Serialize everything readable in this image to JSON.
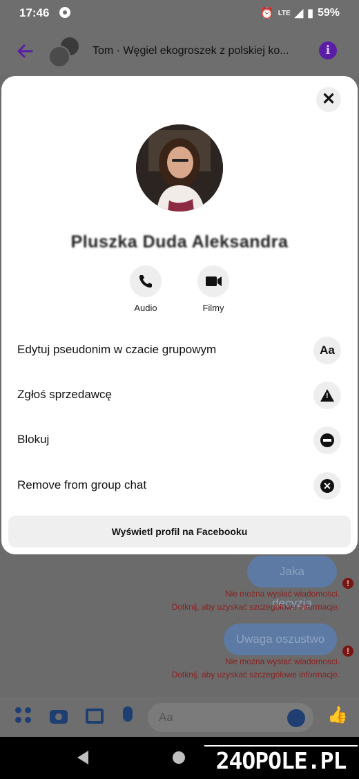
{
  "status_bar": {
    "time": "17:46",
    "network": "LTE",
    "battery": "59%"
  },
  "header": {
    "title": "Tom · Węgiel ekogroszek z polskiej ko..."
  },
  "profile_sheet": {
    "name": "Pluszka Duda Aleksandra",
    "actions": {
      "audio_label": "Audio",
      "video_label": "Filmy"
    },
    "menu": [
      {
        "label": "Edytuj pseudonim w czacie grupowym",
        "icon": "text-aa-icon"
      },
      {
        "label": "Zgłoś sprzedawcę",
        "icon": "warning-icon"
      },
      {
        "label": "Blokuj",
        "icon": "block-icon"
      },
      {
        "label": "Remove from group chat",
        "icon": "remove-circle-icon"
      }
    ],
    "view_profile_label": "Wyświetl profil na Facebooku"
  },
  "chat": {
    "messages": [
      {
        "text": "Jaka decyzja",
        "error_line1": "Nie można wysłać wiadomości.",
        "error_line2": "Dotknij, aby uzyskać szczegółowe informacje."
      },
      {
        "text": "Uwaga oszustwo",
        "error_line1": "Nie można wysłać wiadomości.",
        "error_line2": "Dotknij, aby uzyskać szczegółowe informacje."
      }
    ]
  },
  "composer": {
    "placeholder": "Aa"
  },
  "watermark": "24OPOLE.PL",
  "colors": {
    "accent_purple": "#5b1da6",
    "messenger_blue": "#1f3f73",
    "error_red": "#8c1f1f"
  }
}
